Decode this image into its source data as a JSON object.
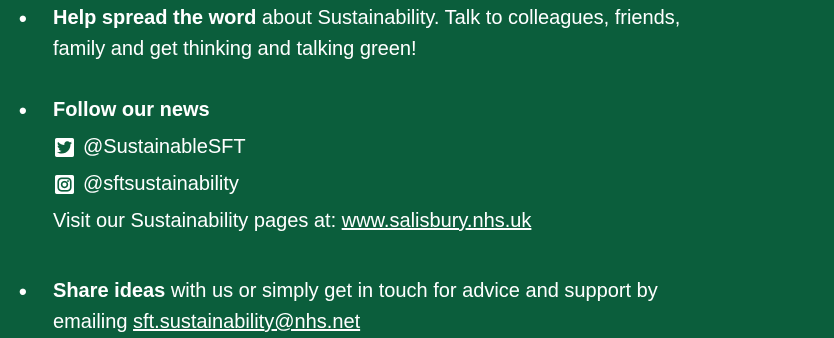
{
  "items": [
    {
      "bold": "Help spread the word",
      "text": " about Sustainability. Talk to colleagues, friends,",
      "text2": "family and get thinking and talking green!"
    },
    {
      "bold": "Follow our news",
      "twitter": "@SustainableSFT",
      "instagram": "@sftsustainability",
      "visit_text": "Visit our Sustainability pages at: ",
      "visit_link": "www.salisbury.nhs.uk"
    },
    {
      "bold": "Share ideas",
      "text": " with us or simply get in touch for advice and support by",
      "text2": "emailing ",
      "email": "sft.sustainability@nhs.net"
    }
  ],
  "bullet": "•",
  "colors": {
    "background": "#0b5e3c",
    "text": "#ffffff"
  },
  "icons": {
    "twitter": "twitter-icon",
    "instagram": "instagram-icon"
  }
}
